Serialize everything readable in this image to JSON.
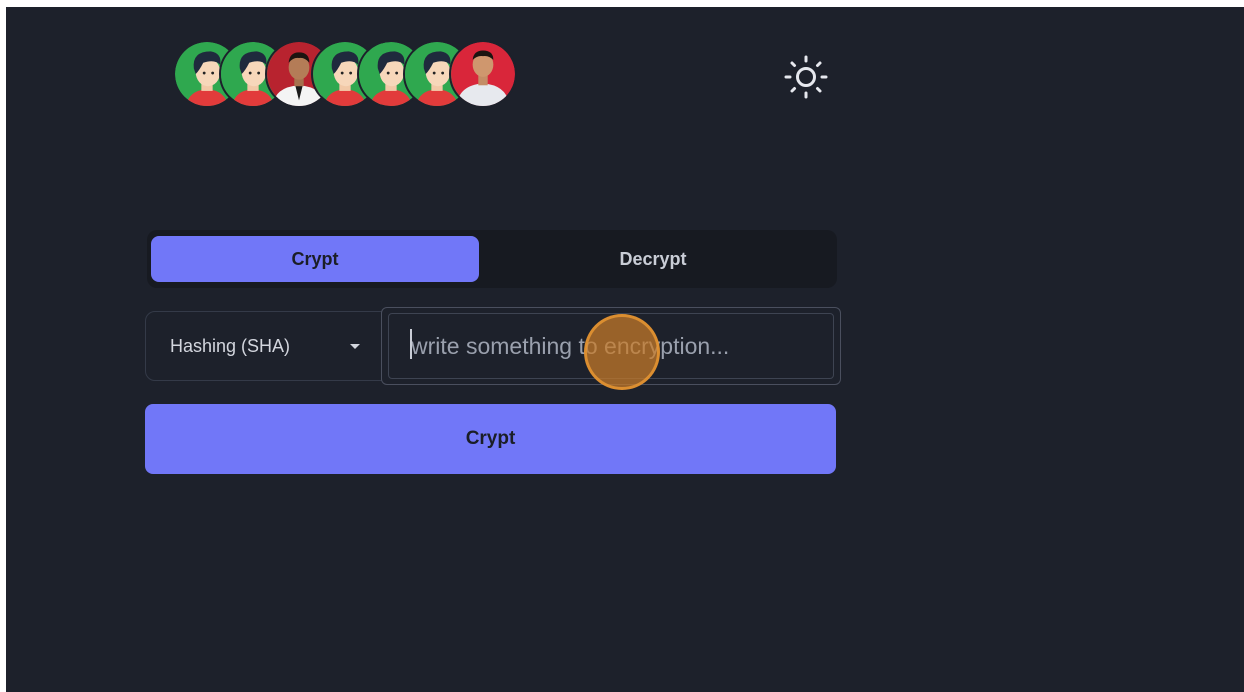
{
  "header": {
    "avatars": [
      {
        "name": "avatar-cartoon-1",
        "kind": "cartoon"
      },
      {
        "name": "avatar-cartoon-2",
        "kind": "cartoon"
      },
      {
        "name": "avatar-photo-1",
        "kind": "photo-suit"
      },
      {
        "name": "avatar-cartoon-3",
        "kind": "cartoon"
      },
      {
        "name": "avatar-cartoon-4",
        "kind": "cartoon"
      },
      {
        "name": "avatar-cartoon-5",
        "kind": "cartoon"
      },
      {
        "name": "avatar-photo-2",
        "kind": "photo-shirt"
      }
    ],
    "theme_icon": "sun-icon"
  },
  "tabs": [
    {
      "label": "Crypt",
      "active": true
    },
    {
      "label": "Decrypt",
      "active": false
    }
  ],
  "form": {
    "algorithm": {
      "selected": "Hashing (SHA)",
      "icon": "caret-down-icon"
    },
    "input": {
      "value": "",
      "placeholder": "write something to encryption..."
    },
    "submit_label": "Crypt"
  },
  "colors": {
    "background": "#1d212b",
    "accent": "#7177f8",
    "tab_bar": "#171a21",
    "cartoon_bg": "#2fa84f",
    "photo_bg": "#d9263a"
  }
}
